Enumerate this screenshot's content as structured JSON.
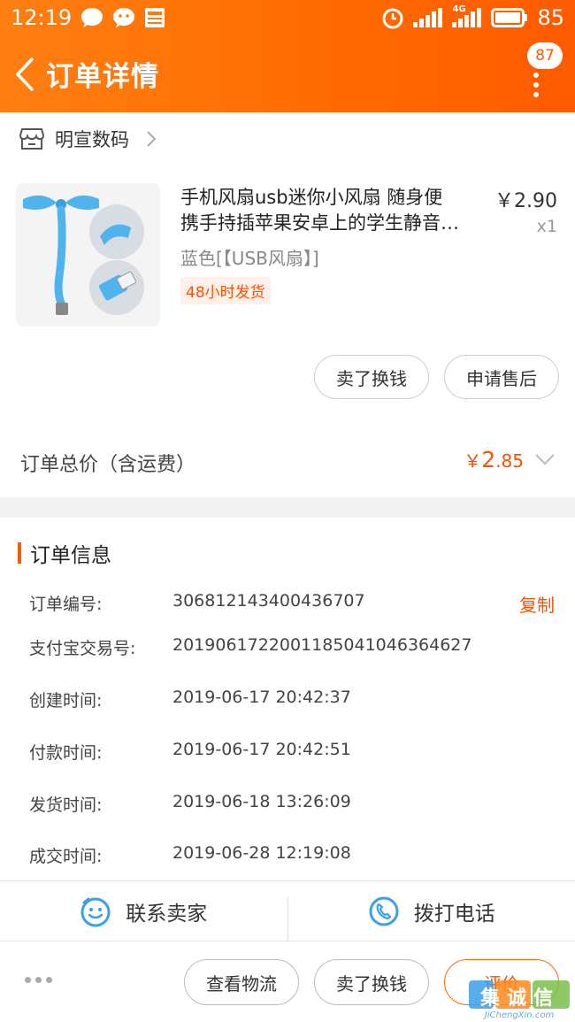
{
  "status_bar": {
    "time": "12:19",
    "battery": "85",
    "network": "4G"
  },
  "header": {
    "title": "订单详情",
    "badge_count": "87"
  },
  "store": {
    "name": "明宣数码"
  },
  "product": {
    "title_line1": "手机风扇usb迷你小风扇 随身便",
    "title_line2": "携手持插苹果安卓上的学生静音…",
    "price": "￥2.90",
    "quantity": "x1",
    "spec": "蓝色[【USB风扇】]",
    "tag": "48小时发货"
  },
  "card_actions": {
    "sell": "卖了换钱",
    "after_sale": "申请售后"
  },
  "total": {
    "label": "订单总价（含运费）",
    "currency": "￥",
    "integer": "2",
    "decimal": ".85"
  },
  "order_info": {
    "title": "订单信息",
    "copy_label": "复制",
    "rows": [
      {
        "label": "订单编号:",
        "value": "306812143400436707"
      },
      {
        "label": "支付宝交易号:",
        "value": "2019061722001185041046364627"
      },
      {
        "label": "创建时间:",
        "value": "2019-06-17 20:42:37"
      },
      {
        "label": "付款时间:",
        "value": "2019-06-17 20:42:51"
      },
      {
        "label": "发货时间:",
        "value": "2019-06-18 13:26:09"
      },
      {
        "label": "成交时间:",
        "value": "2019-06-28 12:19:08"
      }
    ]
  },
  "contact": {
    "seller": "联系卖家",
    "phone": "拨打电话"
  },
  "bottom_actions": {
    "logistics": "查看物流",
    "sell": "卖了换钱",
    "review": "评价"
  },
  "watermark": {
    "text": "集诚信",
    "subtext": "JiChengXin.com"
  },
  "colors": {
    "brand": "#ff6a00",
    "price": "#ff5000",
    "icon_blue": "#3aa0e8"
  },
  "icons": {
    "back": "chevron-left-icon",
    "store": "store-icon",
    "contact": "smile-chat-icon",
    "phone": "phone-icon"
  }
}
